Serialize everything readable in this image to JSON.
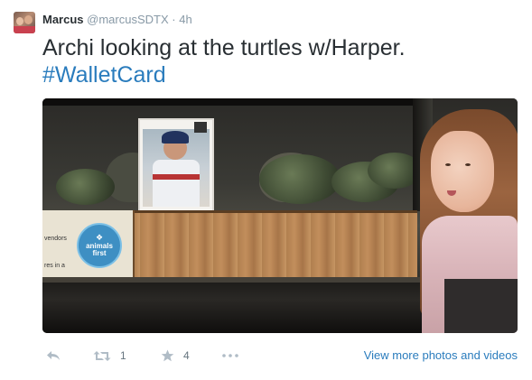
{
  "tweet": {
    "name": "Marcus",
    "handle": "@marcusSDTX",
    "separator": "·",
    "time": "4h",
    "text": "Archi looking at the turtles w/Harper.",
    "hashtag": "#WalletCard"
  },
  "media": {
    "sticker_lines": [
      "animals",
      "first"
    ],
    "panel_text_1": "vendors",
    "panel_text_2": "res in a"
  },
  "actions": {
    "reply_icon": "reply-icon",
    "retweet_icon": "retweet-icon",
    "retweet_count": "1",
    "favorite_icon": "star-icon",
    "favorite_count": "4",
    "more_icon": "more-dots-icon",
    "view_more": "View more photos and videos"
  },
  "colors": {
    "link": "#2a7cbd",
    "text": "#292f33",
    "muted": "#8899a6",
    "icon": "#b0bcc6"
  }
}
